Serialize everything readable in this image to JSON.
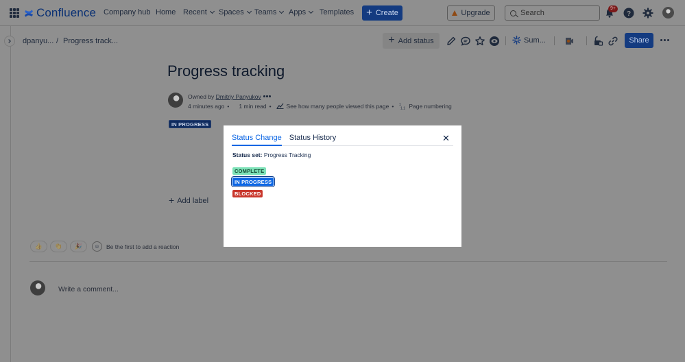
{
  "topnav": {
    "app_name": "Confluence",
    "items": [
      "Company hub",
      "Home",
      "Recent",
      "Spaces",
      "Teams",
      "Apps",
      "Templates"
    ],
    "create_label": "Create",
    "upgrade_label": "Upgrade",
    "search_placeholder": "Search",
    "notification_badge": "9+"
  },
  "breadcrumb": {
    "space": "dpanyu...",
    "separator": "/",
    "page": "Progress track..."
  },
  "toolbar": {
    "add_status_label": "Add status",
    "summarize_label": "Sum...",
    "share_label": "Share"
  },
  "page": {
    "title": "Progress tracking",
    "owned_by_prefix": "Owned by",
    "owner_name": "Dmitriy Panyukov",
    "time_ago": "4 minutes ago",
    "read_time": "1 min read",
    "views_link": "See how many people viewed this page",
    "page_numbering": "Page numbering",
    "status": "IN PROGRESS",
    "add_label": "Add label",
    "reactions_prompt": "Be the first to add a reaction",
    "comment_placeholder": "Write a comment..."
  },
  "dialog": {
    "tabs": [
      "Status Change",
      "Status History"
    ],
    "active_tab": "Status Change",
    "status_set_label": "Status set:",
    "status_set_value": "Progress Tracking",
    "options": [
      {
        "label": "COMPLETE",
        "color": "#7ee2b8"
      },
      {
        "label": "IN PROGRESS",
        "color": "#0c66e4"
      },
      {
        "label": "BLOCKED",
        "color": "#c9372c"
      }
    ],
    "selected_option": "IN PROGRESS"
  },
  "colors": {
    "brand": "#0c66e4",
    "overlay": "#8f8f8f",
    "status_in_progress": "#0c66e4",
    "status_complete": "#7ee2b8",
    "status_blocked": "#c9372c"
  }
}
